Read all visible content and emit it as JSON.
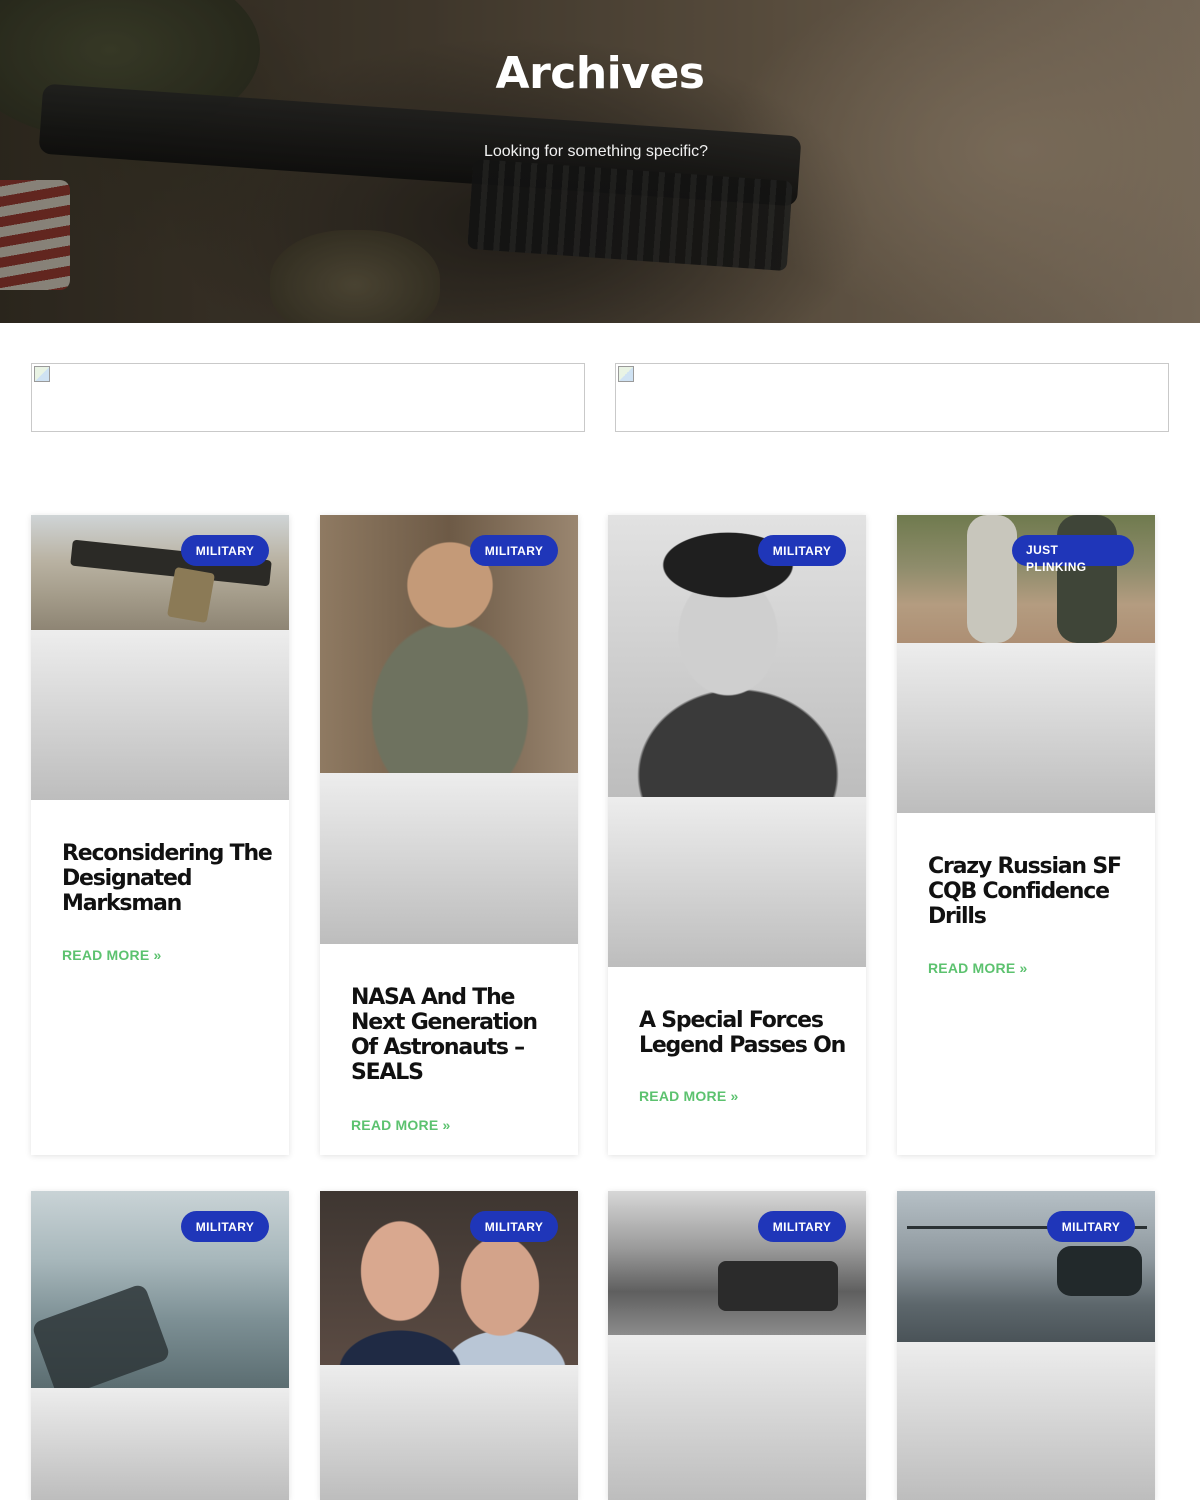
{
  "hero": {
    "title": "Archives",
    "subtitle": "Looking for something specific?"
  },
  "ads": [
    {
      "label": ""
    },
    {
      "label": ""
    }
  ],
  "colors": {
    "badge_bg": "#1f36b9",
    "read_more": "#5cc26f",
    "title": "#111111"
  },
  "posts": [
    {
      "category": "MILITARY",
      "title": "Reconsidering The Designated Marksman",
      "read_more": "READ MORE »"
    },
    {
      "category": "MILITARY",
      "title": "NASA And The Next Generation Of Astronauts – SEALS",
      "read_more": "READ MORE »"
    },
    {
      "category": "MILITARY",
      "title": "A Special Forces Legend Passes On",
      "read_more": "READ MORE »"
    },
    {
      "category": "JUST PLINKING",
      "title": "Crazy Russian SF CQB Confidence Drills",
      "read_more": "READ MORE »"
    },
    {
      "category": "MILITARY"
    },
    {
      "category": "MILITARY"
    },
    {
      "category": "MILITARY"
    },
    {
      "category": "MILITARY"
    }
  ]
}
